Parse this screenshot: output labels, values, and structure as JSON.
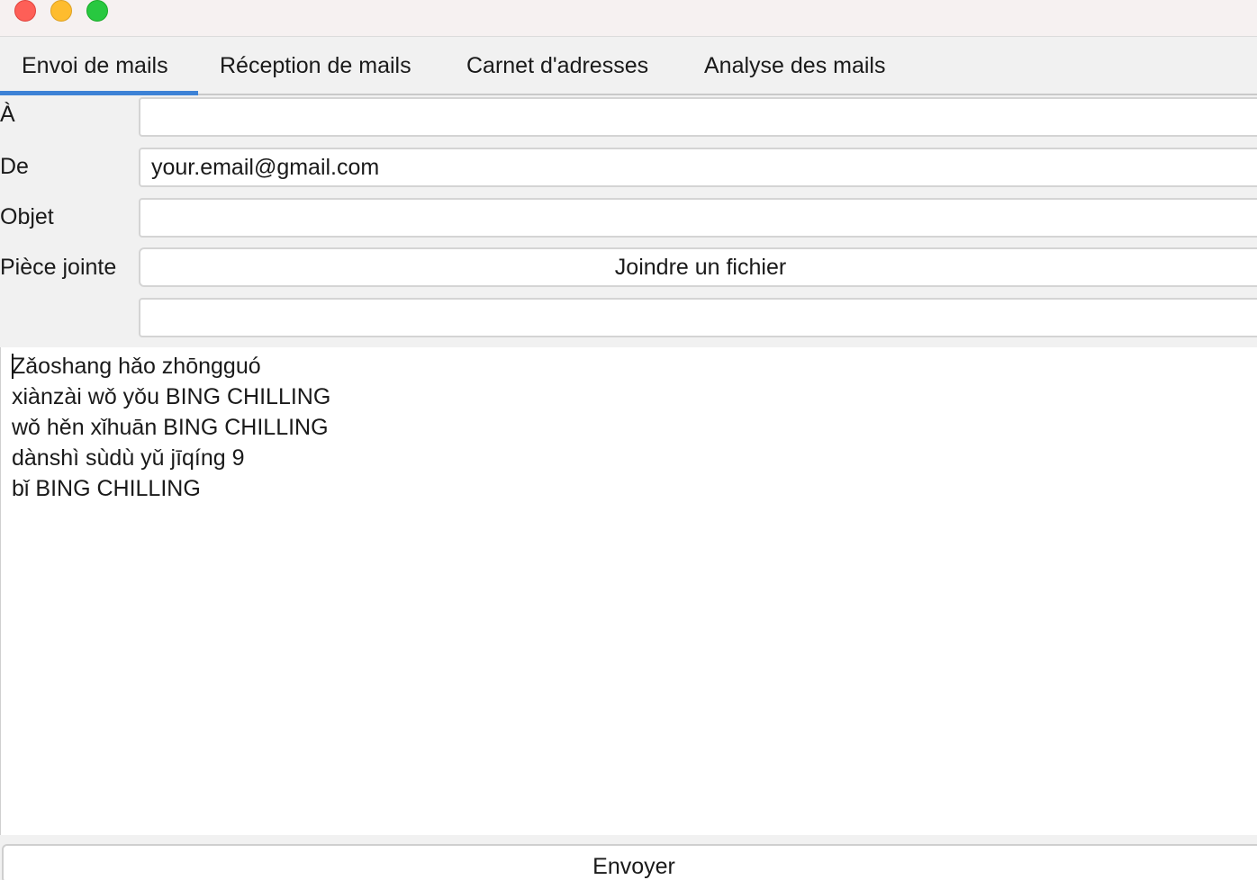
{
  "window": {
    "controls": [
      "close",
      "minimize",
      "maximize"
    ]
  },
  "tabs": [
    {
      "label": "Envoi de mails",
      "active": true
    },
    {
      "label": "Réception de mails",
      "active": false
    },
    {
      "label": "Carnet d'adresses",
      "active": false
    },
    {
      "label": "Analyse des mails",
      "active": false
    }
  ],
  "form": {
    "to": {
      "label": "À",
      "value": ""
    },
    "from": {
      "label": "De",
      "value": "your.email@gmail.com"
    },
    "subject": {
      "label": "Objet",
      "value": ""
    },
    "attachment": {
      "label": "Pièce jointe",
      "button": "Joindre un fichier",
      "value": ""
    }
  },
  "body": {
    "lines": [
      "Zǎoshang hǎo zhōngguó",
      "xiànzài wǒ yǒu BING CHILLING",
      "wǒ hěn xǐhuān BING CHILLING",
      "dànshì sùdù yǔ jīqíng 9",
      "bǐ BING CHILLING"
    ]
  },
  "footer": {
    "send_label": "Envoyer"
  },
  "colors": {
    "accent": "#3d82d6",
    "close": "#fe5f57",
    "minimize": "#febc2e",
    "maximize": "#28c840"
  }
}
